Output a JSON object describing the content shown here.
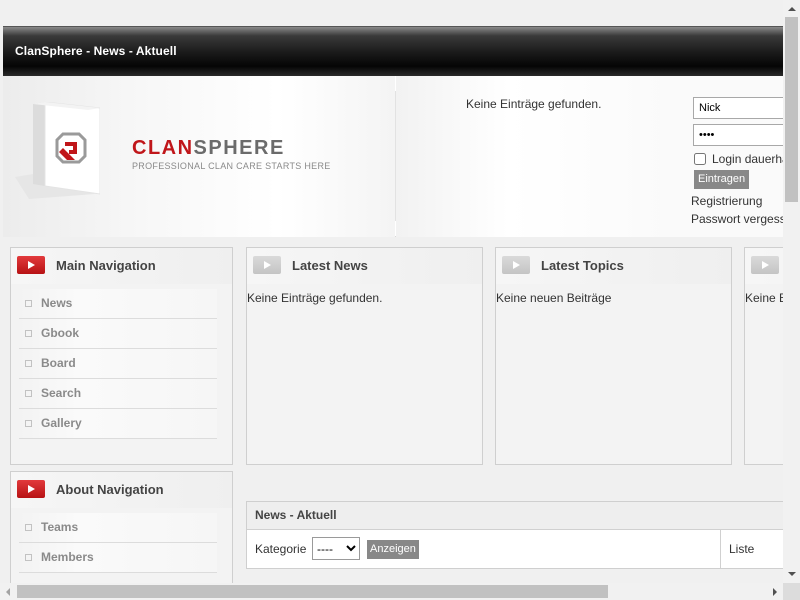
{
  "page": {
    "title": "ClanSphere - News - Aktuell"
  },
  "logo": {
    "brand_red": "CLAN",
    "brand_grey": "SPHERE",
    "tagline": "PROFESSIONAL CLAN CARE STARTS HERE"
  },
  "header": {
    "center_text": "Keine Einträge gefunden."
  },
  "login": {
    "nick_value": "Nick",
    "password_value": "••••",
    "remember_label": "Login dauerhaft",
    "submit_label": "Eintragen",
    "register_link": "Registrierung",
    "forgot_link": "Passwort vergessen"
  },
  "main_nav": {
    "title": "Main Navigation",
    "items": [
      {
        "label": "News"
      },
      {
        "label": "Gbook"
      },
      {
        "label": "Board"
      },
      {
        "label": "Search"
      },
      {
        "label": "Gallery"
      }
    ]
  },
  "about_nav": {
    "title": "About Navigation",
    "items": [
      {
        "label": "Teams"
      },
      {
        "label": "Members"
      }
    ]
  },
  "boxes": [
    {
      "title": "Latest News",
      "content": "Keine Einträge gefunden."
    },
    {
      "title": "Latest Topics",
      "content": "Keine neuen Beiträge"
    },
    {
      "title": "",
      "content": "Keine E"
    }
  ],
  "news_aktuell": {
    "title": "News - Aktuell",
    "category_label": "Kategorie",
    "category_selected": "----",
    "show_button": "Anzeigen",
    "list_label": "Liste"
  },
  "colors": {
    "brand_red": "#c0161a",
    "header_dark": "#1c1c1c",
    "button_grey": "#888888"
  }
}
